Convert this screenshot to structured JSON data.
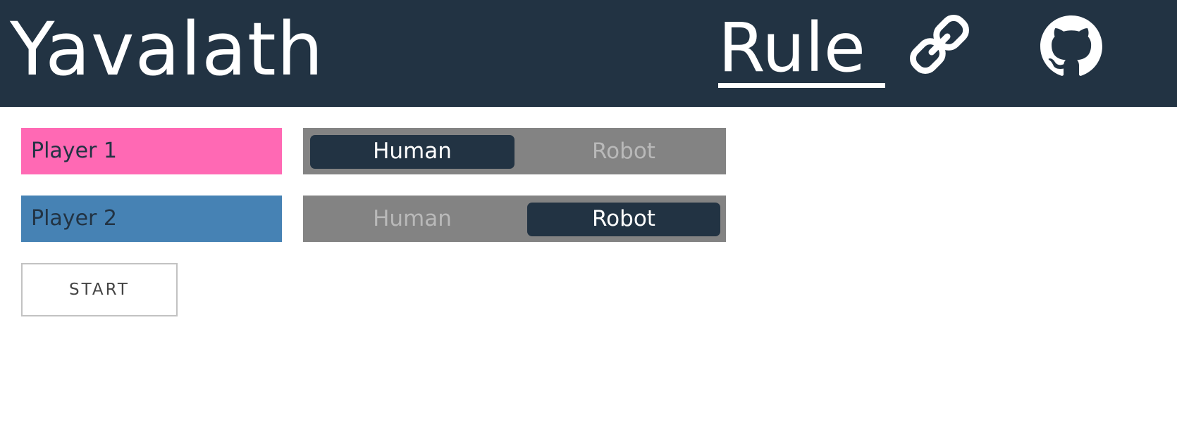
{
  "header": {
    "title": "Yavalath",
    "rule_link_label": "Rule",
    "link_icon": "chain-link-icon",
    "github_icon": "github-icon",
    "background_color": "#223343"
  },
  "players": [
    {
      "label": "Player 1",
      "color": "#ff69b4",
      "options": [
        "Human",
        "Robot"
      ],
      "selected": "Human"
    },
    {
      "label": "Player 2",
      "color": "#4682b4",
      "options": [
        "Human",
        "Robot"
      ],
      "selected": "Robot"
    }
  ],
  "controls": {
    "start_label": "START"
  },
  "colors": {
    "accent_dark": "#223343",
    "toggle_bg": "#838383",
    "inactive_text": "#b9b9b9"
  }
}
